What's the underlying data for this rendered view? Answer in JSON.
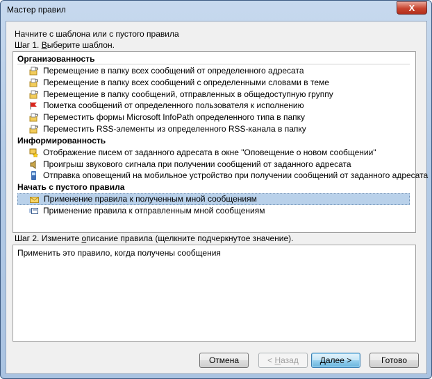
{
  "window": {
    "title": "Мастер правил",
    "close_label": "X"
  },
  "intro": "Начните с шаблона или с пустого правила",
  "step1": {
    "prefix": "Шаг 1. ",
    "accel": "В",
    "rest": "ыберите шаблон."
  },
  "groups": [
    {
      "header": "Организованность",
      "items": [
        {
          "label": "Перемещение в папку всех сообщений от определенного адресата",
          "icon": "move-folder-icon"
        },
        {
          "label": "Перемещение в папку всех сообщений с определенными словами в теме",
          "icon": "move-folder-icon"
        },
        {
          "label": "Перемещение в папку сообщений, отправленных в общедоступную группу",
          "icon": "move-folder-icon"
        },
        {
          "label": "Пометка сообщений от определенного пользователя к исполнению",
          "icon": "flag-icon"
        },
        {
          "label": "Переместить формы Microsoft InfoPath определенного типа в папку",
          "icon": "move-folder-icon"
        },
        {
          "label": "Переместить RSS-элементы из определенного RSS-канала в папку",
          "icon": "move-folder-icon"
        }
      ]
    },
    {
      "header": "Информированность",
      "items": [
        {
          "label": "Отображение писем от заданного адресата в окне \"Оповещение о новом сообщении\"",
          "icon": "alert-star-icon"
        },
        {
          "label": "Проигрыш звукового сигнала при получении сообщений от заданного адресата",
          "icon": "speaker-icon"
        },
        {
          "label": "Отправка оповещений на мобильное устройство при получении сообщений от заданного адресата",
          "icon": "mobile-phone-icon"
        }
      ]
    },
    {
      "header": "Начать с пустого правила",
      "items": [
        {
          "label": "Применение правила к полученным мной сообщениям",
          "icon": "envelope-icon",
          "selected": true
        },
        {
          "label": "Применение правила к отправленным мной сообщениям",
          "icon": "sent-mail-icon"
        }
      ]
    }
  ],
  "step2": {
    "prefix": "Шаг 2. Измените ",
    "accel": "о",
    "rest": "писание правила (щелкните подчеркнутое значение)."
  },
  "description": "Применить это правило, когда получены сообщения",
  "buttons": {
    "cancel": "Отмена",
    "back_prefix": "< ",
    "back_accel": "Н",
    "back_rest": "азад",
    "next": "Далее >",
    "finish": "Готово"
  }
}
